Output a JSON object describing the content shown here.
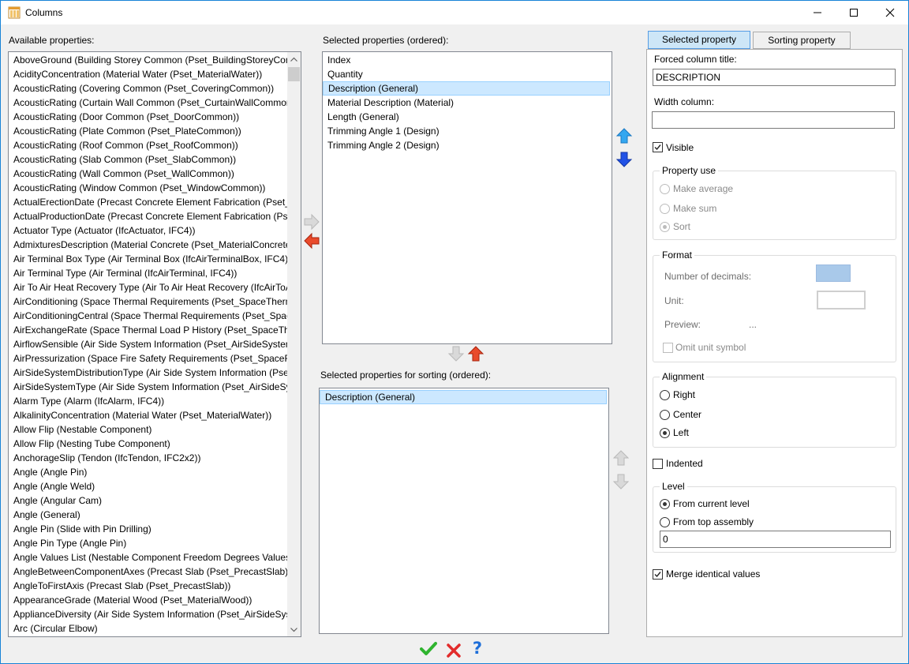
{
  "window": {
    "title": "Columns",
    "controls": [
      "minimize",
      "maximize",
      "close"
    ]
  },
  "available": {
    "label": "Available properties:",
    "items": [
      "AboveGround (Building Storey Common (Pset_BuildingStoreyCom",
      "AcidityConcentration (Material Water (Pset_MaterialWater))",
      "AcousticRating (Covering Common (Pset_CoveringCommon))",
      "AcousticRating (Curtain Wall Common (Pset_CurtainWallCommon",
      "AcousticRating (Door Common (Pset_DoorCommon))",
      "AcousticRating (Plate Common (Pset_PlateCommon))",
      "AcousticRating (Roof Common (Pset_RoofCommon))",
      "AcousticRating (Slab Common (Pset_SlabCommon))",
      "AcousticRating (Wall Common (Pset_WallCommon))",
      "AcousticRating (Window Common (Pset_WindowCommon))",
      "ActualErectionDate (Precast Concrete Element Fabrication (Pset_I",
      "ActualProductionDate (Precast Concrete Element Fabrication (Ps",
      "Actuator Type (Actuator (IfcActuator, IFC4))",
      "AdmixturesDescription (Material Concrete (Pset_MaterialConcrete",
      "Air Terminal Box Type (Air Terminal Box (IfcAirTerminalBox, IFC4))",
      "Air Terminal Type (Air Terminal (IfcAirTerminal, IFC4))",
      "Air To Air Heat Recovery Type (Air To Air Heat Recovery (IfcAirToA",
      "AirConditioning (Space Thermal Requirements (Pset_SpaceTherm",
      "AirConditioningCentral (Space Thermal Requirements (Pset_Spac",
      "AirExchangeRate (Space Thermal Load P History (Pset_SpaceTherr",
      "AirflowSensible (Air Side System Information (Pset_AirSideSystem",
      "AirPressurization (Space Fire Safety Requirements (Pset_SpaceFir",
      "AirSideSystemDistributionType (Air Side System Information (Pse",
      "AirSideSystemType (Air Side System Information (Pset_AirSideSys",
      "Alarm Type (Alarm (IfcAlarm, IFC4))",
      "AlkalinityConcentration (Material Water (Pset_MaterialWater))",
      "Allow Flip (Nestable Component)",
      "Allow Flip (Nesting Tube Component)",
      "AnchorageSlip (Tendon (IfcTendon, IFC2x2))",
      "Angle (Angle Pin)",
      "Angle (Angle Weld)",
      "Angle (Angular Cam)",
      "Angle (General)",
      "Angle Pin (Slide with Pin Drilling)",
      "Angle Pin Type (Angle Pin)",
      "Angle Values List (Nestable Component Freedom Degrees Values)",
      "AngleBetweenComponentAxes (Precast Slab (Pset_PrecastSlab))",
      "AngleToFirstAxis (Precast Slab (Pset_PrecastSlab))",
      "AppearanceGrade (Material Wood (Pset_MaterialWood))",
      "ApplianceDiversity (Air Side System Information (Pset_AirSideSyst",
      "Arc (Circular Elbow)"
    ]
  },
  "selected": {
    "label": "Selected properties (ordered):",
    "items": [
      "Index",
      "Quantity",
      "Description (General)",
      "Material Description (Material)",
      "Length (General)",
      "Trimming Angle 1 (Design)",
      "Trimming Angle 2 (Design)"
    ],
    "selected_index": 2
  },
  "sorting": {
    "label": "Selected properties for sorting (ordered):",
    "items": [
      "Description (General)"
    ],
    "selected_index": 0
  },
  "tabs": {
    "selected_property": "Selected property",
    "sorting_property": "Sorting property",
    "active": "selected_property"
  },
  "panel": {
    "forced_title_label": "Forced column title:",
    "forced_title_value": "DESCRIPTION",
    "width_label": "Width column:",
    "width_value": "",
    "visible_label": "Visible",
    "visible_checked": true,
    "property_use": {
      "title": "Property use",
      "make_average": "Make average",
      "make_sum": "Make sum",
      "sort": "Sort",
      "selected": "sort"
    },
    "format": {
      "title": "Format",
      "decimals_label": "Number of decimals:",
      "unit_label": "Unit:",
      "preview_label": "Preview:",
      "preview_value": "...",
      "omit_unit_label": "Omit unit symbol"
    },
    "alignment": {
      "title": "Alignment",
      "right": "Right",
      "center": "Center",
      "left": "Left",
      "selected": "left"
    },
    "indented_label": "Indented",
    "indented_checked": false,
    "level": {
      "title": "Level",
      "from_current": "From current level",
      "from_top": "From top assembly",
      "selected": "from_current",
      "value": "0"
    },
    "merge_label": "Merge identical values",
    "merge_checked": true
  },
  "footer": {
    "ok_icon": "checkmark-icon",
    "cancel_icon": "x-icon",
    "help_icon": "question-icon",
    "help_text": "?"
  },
  "colors": {
    "selection": "#cce8ff",
    "tab_active": "#cde6f7",
    "arrow_blue": "#1e63e9",
    "arrow_red": "#e53010",
    "ok_green": "#2fb42f"
  }
}
